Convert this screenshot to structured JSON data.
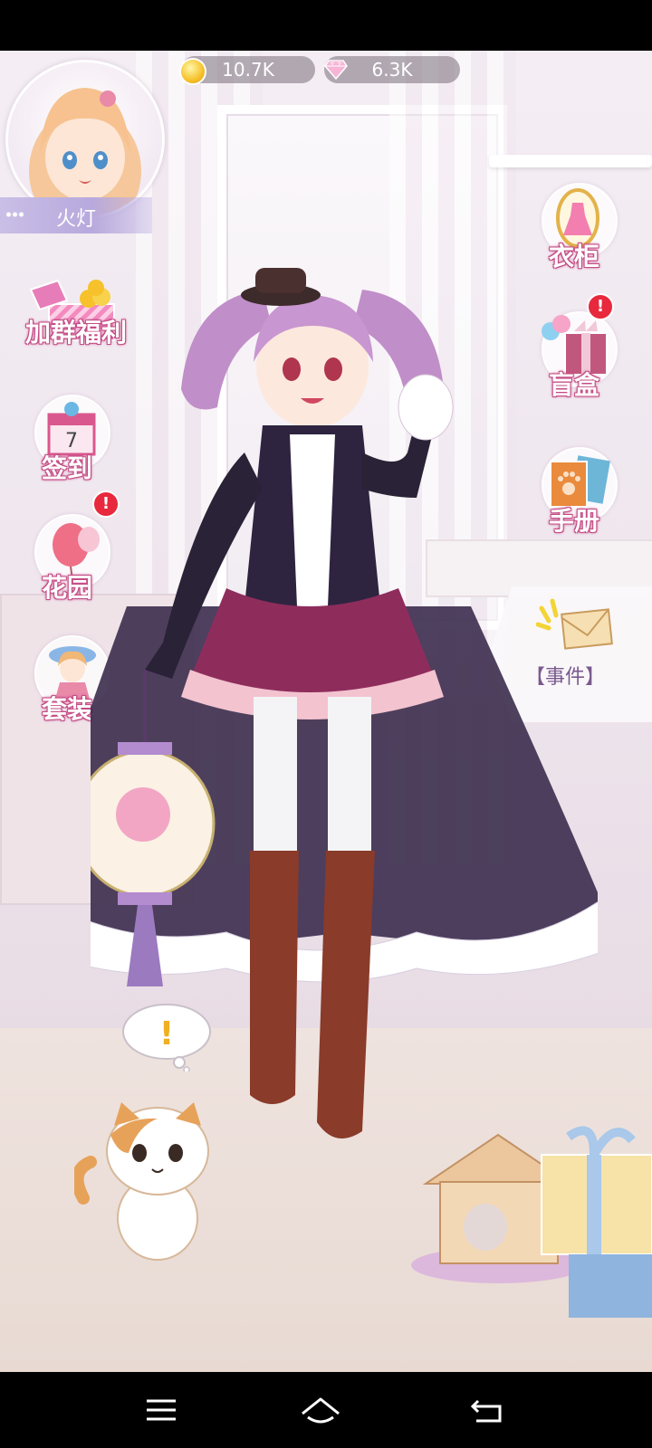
{
  "currencies": {
    "coins": "10.7K",
    "gems": "6.3K"
  },
  "player": {
    "name": "火灯"
  },
  "left_menu": [
    {
      "label": "加群福利",
      "icon": "gift-box-icon"
    },
    {
      "label": "签到",
      "icon": "calendar-gift-icon",
      "calendar_day": "7"
    },
    {
      "label": "花园",
      "icon": "balloon-icon",
      "badge": "!"
    },
    {
      "label": "套装",
      "icon": "outfit-doll-icon"
    }
  ],
  "right_menu": [
    {
      "label": "衣柜",
      "icon": "dress-mirror-icon"
    },
    {
      "label": "盲盒",
      "icon": "blind-box-icon",
      "badge": "!"
    },
    {
      "label": "手册",
      "icon": "paw-book-icon"
    }
  ],
  "event_tab": {
    "label": "【事件】",
    "icon": "envelope-icon"
  },
  "cat_thought": "!",
  "colors": {
    "label_outline": "#c44d86",
    "badge_red": "#e8283c",
    "name_bar": "#b7a9dd"
  }
}
